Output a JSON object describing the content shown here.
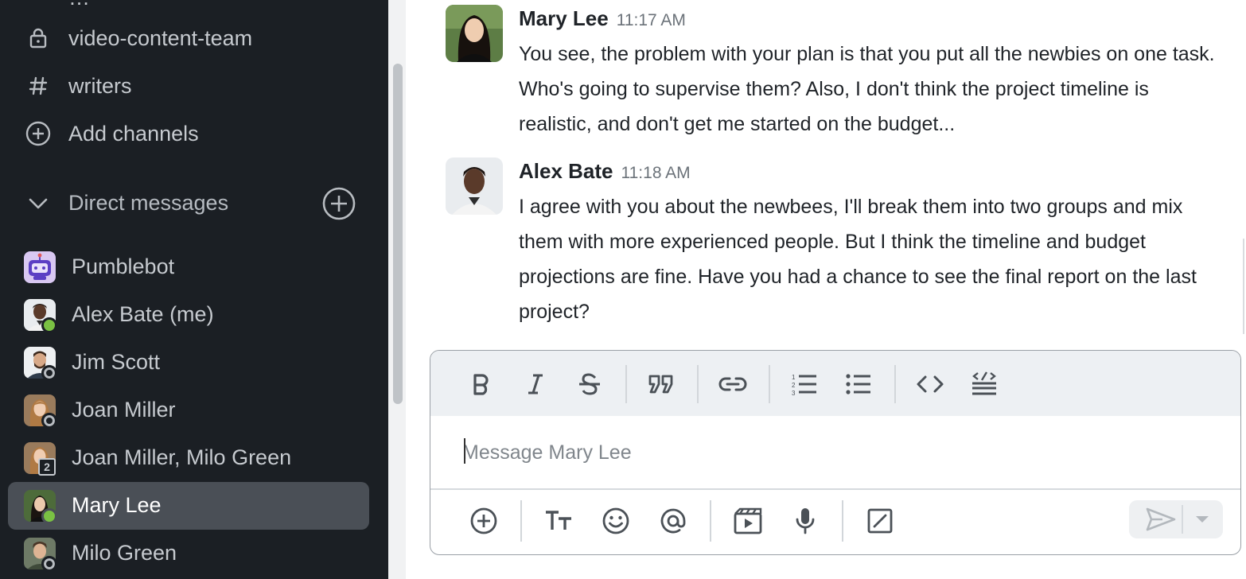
{
  "sidebar": {
    "channels": [
      {
        "name": "video-content-team",
        "icon": "lock-icon"
      },
      {
        "name": "writers",
        "icon": "hash-icon"
      }
    ],
    "add_channels_label": "Add channels",
    "direct_messages_header": "Direct messages",
    "direct_messages": [
      {
        "name": "Pumblebot",
        "status": "bot"
      },
      {
        "name": "Alex Bate (me)",
        "status": "online"
      },
      {
        "name": "Jim Scott",
        "status": "offline"
      },
      {
        "name": "Joan Miller",
        "status": "offline"
      },
      {
        "name": "Joan Miller, Milo Green",
        "status": "group",
        "member_count": "2"
      },
      {
        "name": "Mary Lee",
        "status": "online",
        "active": true
      },
      {
        "name": "Milo Green",
        "status": "offline"
      }
    ]
  },
  "messages": [
    {
      "author": "Mary Lee",
      "time": "11:17 AM",
      "text": "You see, the problem with your plan is that you put all the newbies on one task. Who's going to supervise them? Also, I don't think the project timeline is realistic, and don't get me started on the budget..."
    },
    {
      "author": "Alex Bate",
      "time": "11:18 AM",
      "text": "I agree with you about the newbees, I'll break them into two groups and mix them with more experienced people. But I think the timeline and budget projections are fine. Have you had a chance to see the final report on the last project?"
    }
  ],
  "composer": {
    "placeholder": "Message Mary Lee",
    "formatting_tools": [
      "bold-icon",
      "italic-icon",
      "strikethrough-icon",
      "quote-icon",
      "link-icon",
      "ordered-list-icon",
      "bullet-list-icon",
      "code-icon",
      "code-block-icon"
    ],
    "actions": [
      "add-icon",
      "text-format-icon",
      "emoji-icon",
      "mention-icon",
      "video-clip-icon",
      "microphone-icon",
      "slash-command-icon"
    ]
  },
  "colors": {
    "sidebar_bg": "#1b1f24",
    "active_item_bg": "#4a4f56",
    "online_status": "#7ac143"
  }
}
